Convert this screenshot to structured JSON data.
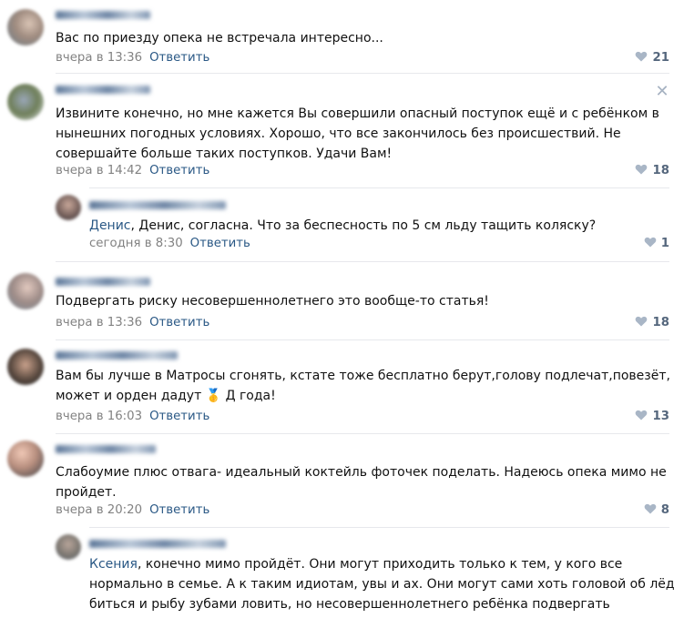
{
  "comments": [
    {
      "text": "Вас по приезду опека не встречала интересно...",
      "date": "вчера в 13:36",
      "reply": "Ответить",
      "likes": "21"
    },
    {
      "lines": [
        "Извините конечно, но мне кажется Вы совершили опасный поступок ещё и с ребёнком в",
        "нынешних погодных условиях. Хорошо, что все закончилось без происшествий. Не",
        "совершайте больше таких поступков. Удачи Вам!"
      ],
      "date": "вчера в 14:42",
      "reply": "Ответить",
      "likes": "18",
      "close": "✕"
    },
    {
      "mention": "Денис",
      "text": ", Денис, согласна. Что за беспесность по 5 см льду тащить коляску?",
      "date": "сегодня в 8:30",
      "reply": "Ответить",
      "likes": "1"
    },
    {
      "text": "Подвергать риску несовершеннолетнего это вообще-то статья!",
      "date": "вчера в 13:36",
      "reply": "Ответить",
      "likes": "18"
    },
    {
      "lines": [
        "Вам бы лучше в Матросы сгонять, кстате тоже бесплатно берут,голову подлечат,повезёт,",
        "может и орден дадут 🥇 Д года!"
      ],
      "date": "вчера в 16:03",
      "reply": "Ответить",
      "likes": "13"
    },
    {
      "lines": [
        "Слабоумие плюс отвага- идеальный коктейль фоточек поделать. Надеюсь опека мимо не",
        "пройдет."
      ],
      "date": "вчера в 20:20",
      "reply": "Ответить",
      "likes": "8"
    },
    {
      "mention": "Ксения",
      "lines": [
        ", конечно мимо пройдёт. Они могут приходить только к тем, у кого все",
        "нормально в семье. А к таким идиотам, увы и ах. Они могут сами хоть головой об лёд",
        "биться и рыбу зубами ловить, но несовершеннолетнего ребёнка подвергать"
      ]
    }
  ],
  "icons": {
    "like": "heart-icon",
    "close": "close-icon"
  },
  "colors": {
    "link": "#2a5885",
    "date": "#828282",
    "likes": "#55677d",
    "separator": "#e7e8ec"
  }
}
